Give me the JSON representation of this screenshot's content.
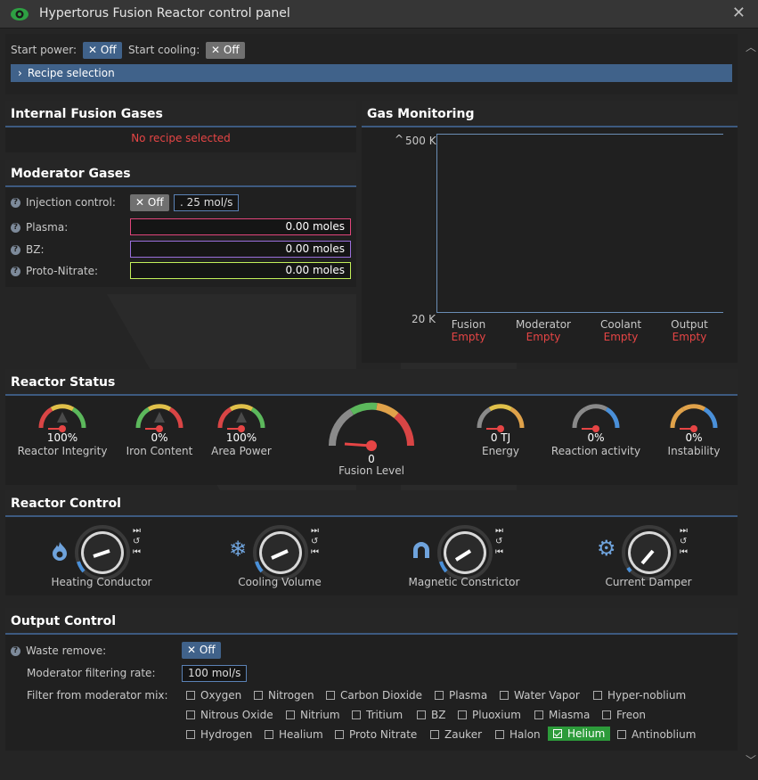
{
  "window": {
    "title": "Hypertorus Fusion Reactor control panel",
    "close_glyph": "✕"
  },
  "power": {
    "start_power_label": "Start power:",
    "start_power_state": "✕ Off",
    "start_cooling_label": "Start cooling:",
    "start_cooling_state": "✕ Off",
    "recipe_label": "Recipe selection"
  },
  "internal_gases": {
    "title": "Internal Fusion Gases",
    "empty_text": "No recipe selected"
  },
  "moderator": {
    "title": "Moderator Gases",
    "injection_label": "Injection control:",
    "injection_state": "✕ Off",
    "injection_rate": ". 25 mol/s",
    "gases": [
      {
        "label": "Plasma:",
        "value": "0.00 moles",
        "color": "#e0457b"
      },
      {
        "label": "BZ:",
        "value": "0.00 moles",
        "color": "#9a6fdc"
      },
      {
        "label": "Proto-Nitrate:",
        "value": "0.00 moles",
        "color": "#c2ef5a"
      }
    ]
  },
  "gas_monitoring": {
    "title": "Gas Monitoring",
    "y_top": "500 K",
    "y_bottom": "20 K",
    "columns": [
      {
        "name": "Fusion",
        "status": "Empty"
      },
      {
        "name": "Moderator",
        "status": "Empty"
      },
      {
        "name": "Coolant",
        "status": "Empty"
      },
      {
        "name": "Output",
        "status": "Empty"
      }
    ]
  },
  "reactor_status": {
    "title": "Reactor Status",
    "gauges": [
      {
        "value": "100%",
        "label": "Reactor Integrity",
        "level": 1.0
      },
      {
        "value": "0%",
        "label": "Iron Content",
        "level": 0.0
      },
      {
        "value": "100%",
        "label": "Area Power",
        "level": 1.0
      },
      {
        "value": "0",
        "label": "Fusion Level",
        "level": 0.0
      },
      {
        "value": "0 TJ",
        "label": "Energy",
        "level": 0.0
      },
      {
        "value": "0%",
        "label": "Reaction activity",
        "level": 0.0
      },
      {
        "value": "0%",
        "label": "Instability",
        "level": 0.0
      }
    ]
  },
  "reactor_control": {
    "title": "Reactor Control",
    "knobs": [
      {
        "label": "Heating Conductor",
        "icon": "flame-icon"
      },
      {
        "label": "Cooling Volume",
        "icon": "snowflake-icon"
      },
      {
        "label": "Magnetic Constrictor",
        "icon": "magnet-icon"
      },
      {
        "label": "Current Damper",
        "icon": "gear-icon"
      }
    ]
  },
  "output_control": {
    "title": "Output Control",
    "waste_label": "Waste remove:",
    "waste_state": "✕ Off",
    "filter_rate_label": "Moderator filtering rate:",
    "filter_rate_value": "100 mol/s",
    "filter_label": "Filter from moderator mix:",
    "filters": [
      "Oxygen",
      "Nitrogen",
      "Carbon Dioxide",
      "Plasma",
      "Water Vapor",
      "Hyper-noblium",
      "Nitrous Oxide",
      "Nitrium",
      "Tritium",
      "BZ",
      "Pluoxium",
      "Miasma",
      "Freon",
      "Hydrogen",
      "Healium",
      "Proto Nitrate",
      "Zauker",
      "Halon",
      "Helium",
      "Antinoblium"
    ],
    "active_filter": "Helium"
  },
  "colors": {
    "accent": "#40628a",
    "header_line": "#3d5a80",
    "danger": "#e64545",
    "active": "#2c9b3a"
  }
}
